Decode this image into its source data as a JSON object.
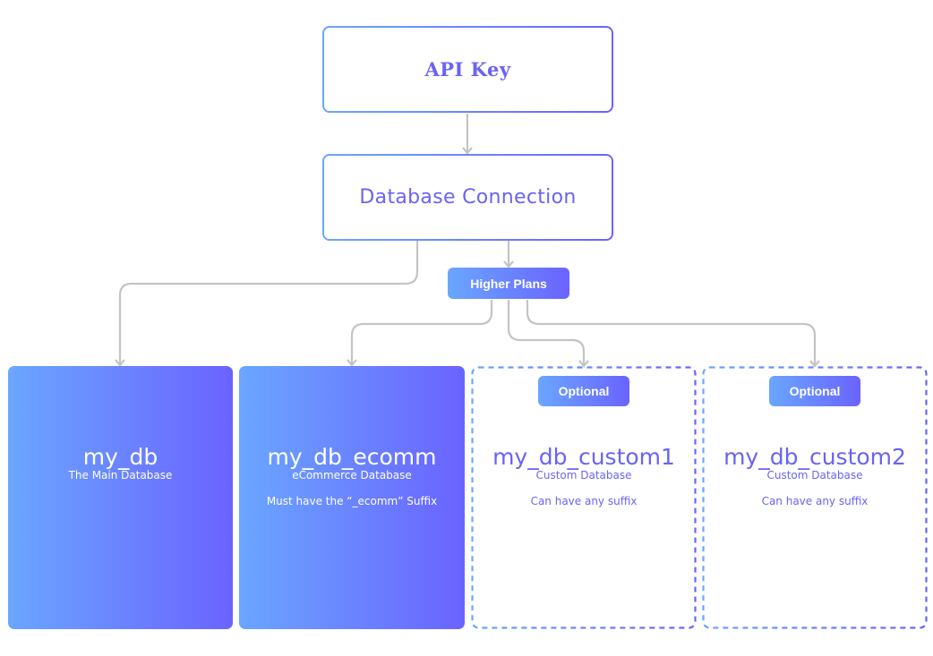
{
  "diagram": {
    "nodes": {
      "api_key": {
        "label": "API Key"
      },
      "database_connection": {
        "label": "Database Connection"
      },
      "higher_plans": {
        "label": "Higher Plans"
      }
    },
    "databases": [
      {
        "name": "my_db",
        "subtitle": "The Main Database",
        "note": "",
        "optional": false
      },
      {
        "name": "my_db_ecomm",
        "subtitle": "eCommerce Database",
        "note": "Must have the “_ecomm” Suffix",
        "optional": false
      },
      {
        "name": "my_db_custom1",
        "subtitle": "Custom Database",
        "note": "Can have any suffix",
        "optional": true,
        "badge": "Optional"
      },
      {
        "name": "my_db_custom2",
        "subtitle": "Custom Database",
        "note": "Can have any suffix",
        "optional": true,
        "badge": "Optional"
      }
    ],
    "edges": [
      {
        "from": "API Key",
        "to": "Database Connection"
      },
      {
        "from": "Database Connection",
        "to": "my_db"
      },
      {
        "from": "Database Connection",
        "to": "Higher Plans"
      },
      {
        "from": "Higher Plans",
        "to": "my_db_ecomm"
      },
      {
        "from": "Higher Plans",
        "to": "my_db_custom1"
      },
      {
        "from": "Higher Plans",
        "to": "my_db_custom2"
      }
    ],
    "colors": {
      "gradient_start": "#6aa6ff",
      "gradient_end": "#6a63ff",
      "text_accent": "#6a63f5",
      "connector": "#c4c4c4"
    }
  }
}
